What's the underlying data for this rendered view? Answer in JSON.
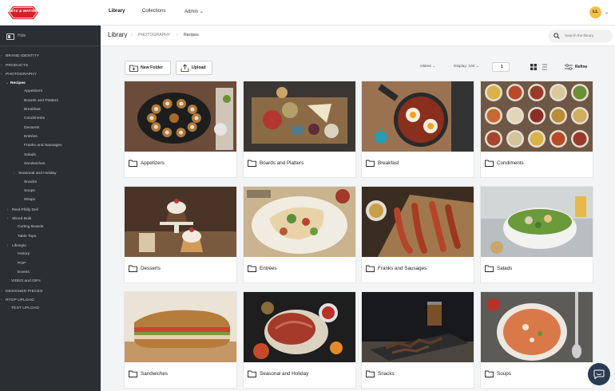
{
  "topbar": {
    "logo_text": "DIETZ & WATSON",
    "nav": [
      "Library",
      "Collections",
      "Admin"
    ],
    "user_initials": "LL"
  },
  "sidebar": {
    "hide_label": "Hide",
    "tree": [
      {
        "label": "BRAND IDENTITY",
        "caret": "›"
      },
      {
        "label": "PRODUCTS",
        "caret": "›"
      },
      {
        "label": "PHOTOGRAPHY",
        "caret": "›"
      },
      {
        "label": "Recipes",
        "caret": "⌄"
      },
      {
        "label": "Appetizers",
        "caret": ""
      },
      {
        "label": "Boards and Platters",
        "caret": ""
      },
      {
        "label": "Breakfast",
        "caret": ""
      },
      {
        "label": "Condiments",
        "caret": ""
      },
      {
        "label": "Desserts",
        "caret": ""
      },
      {
        "label": "Entrées",
        "caret": ""
      },
      {
        "label": "Franks and Sausages",
        "caret": ""
      },
      {
        "label": "Salads",
        "caret": ""
      },
      {
        "label": "Sandwiches",
        "caret": ""
      },
      {
        "label": "Seasonal and Holiday",
        "caret": "›"
      },
      {
        "label": "Snacks",
        "caret": ""
      },
      {
        "label": "Soups",
        "caret": ""
      },
      {
        "label": "Wraps",
        "caret": ""
      },
      {
        "label": "Real Philly Deli",
        "caret": "›"
      },
      {
        "label": "Sliced Bulk",
        "caret": "›"
      },
      {
        "label": "Cutting Boards",
        "caret": ""
      },
      {
        "label": "Table Tops",
        "caret": ""
      },
      {
        "label": "Lifestyle",
        "caret": "›"
      },
      {
        "label": "History",
        "caret": ""
      },
      {
        "label": "POP",
        "caret": ""
      },
      {
        "label": "Events",
        "caret": ""
      },
      {
        "label": "VIDEO and GIFs",
        "caret": ""
      },
      {
        "label": "DESIGNED PIECES",
        "caret": "›"
      },
      {
        "label": "RTOP UPLOAD",
        "caret": "›"
      },
      {
        "label": "TEST UPLOAD",
        "caret": ""
      }
    ]
  },
  "header": {
    "breadcrumb": [
      "Library",
      "PHOTOGRAPHY",
      "Recipes"
    ],
    "search_placeholder": "Search the library"
  },
  "toolbar": {
    "new_folder": "New Folder",
    "upload": "Upload",
    "sort": "Oldest ⌄",
    "display": "Display: 100 ⌄",
    "page": "1",
    "refine": "Refine"
  },
  "folders": [
    {
      "label": "Appetizers",
      "theme": "appetizers"
    },
    {
      "label": "Boards and Platters",
      "theme": "boards"
    },
    {
      "label": "Breakfast",
      "theme": "breakfast"
    },
    {
      "label": "Condiments",
      "theme": "condiments"
    },
    {
      "label": "Desserts",
      "theme": "desserts"
    },
    {
      "label": "Entrées",
      "theme": "entrees"
    },
    {
      "label": "Franks and Sausages",
      "theme": "franks"
    },
    {
      "label": "Salads",
      "theme": "salads"
    },
    {
      "label": "Sandwiches",
      "theme": "sandwiches"
    },
    {
      "label": "Seasonal and Holiday",
      "theme": "seasonal"
    },
    {
      "label": "Snacks",
      "theme": "snacks"
    },
    {
      "label": "Soups",
      "theme": "soups"
    }
  ],
  "colors": {
    "sidebar_bg": "#2b2f33",
    "brand_red": "#d6202a",
    "avatar": "#f2c14e",
    "chat_bg": "#2a3c52"
  }
}
